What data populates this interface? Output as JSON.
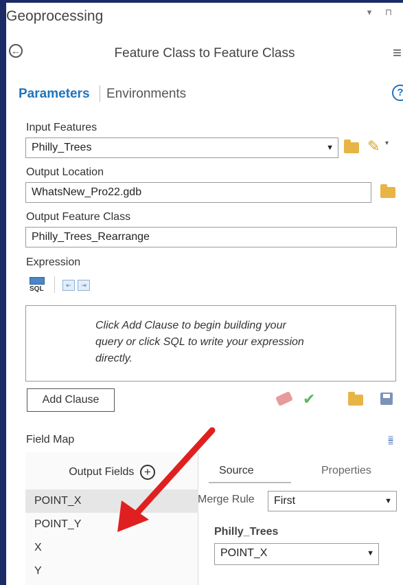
{
  "pane": {
    "title": "Geoprocessing",
    "controls": "▾ ⊓"
  },
  "tool": {
    "title": "Feature Class to Feature Class",
    "back_glyph": "←",
    "menu_glyph": "≡"
  },
  "tabs": {
    "parameters": "Parameters",
    "environments": "Environments",
    "help_glyph": "?"
  },
  "params": {
    "input_features_label": "Input Features",
    "input_features_value": "Philly_Trees",
    "output_location_label": "Output Location",
    "output_location_value": "WhatsNew_Pro22.gdb",
    "output_fc_label": "Output Feature Class",
    "output_fc_value": "Philly_Trees_Rearrange",
    "expression_label": "Expression",
    "sql_text": "SQL",
    "expression_hint": "Click Add Clause to begin building your query or click SQL to write your expression directly.",
    "add_clause": "Add Clause"
  },
  "field_map": {
    "label": "Field Map",
    "output_fields_header": "Output Fields",
    "fields": [
      "POINT_X",
      "POINT_Y",
      "X",
      "Y"
    ],
    "selected_index": 0,
    "source_tab": "Source",
    "properties_tab": "Properties",
    "merge_rule_label": "Merge Rule",
    "merge_rule_value": "First",
    "source_table": "Philly_Trees",
    "source_field": "POINT_X"
  },
  "colors": {
    "accent": "#1e73be",
    "frame": "#1a2b66",
    "annotation_arrow": "#e02020"
  }
}
